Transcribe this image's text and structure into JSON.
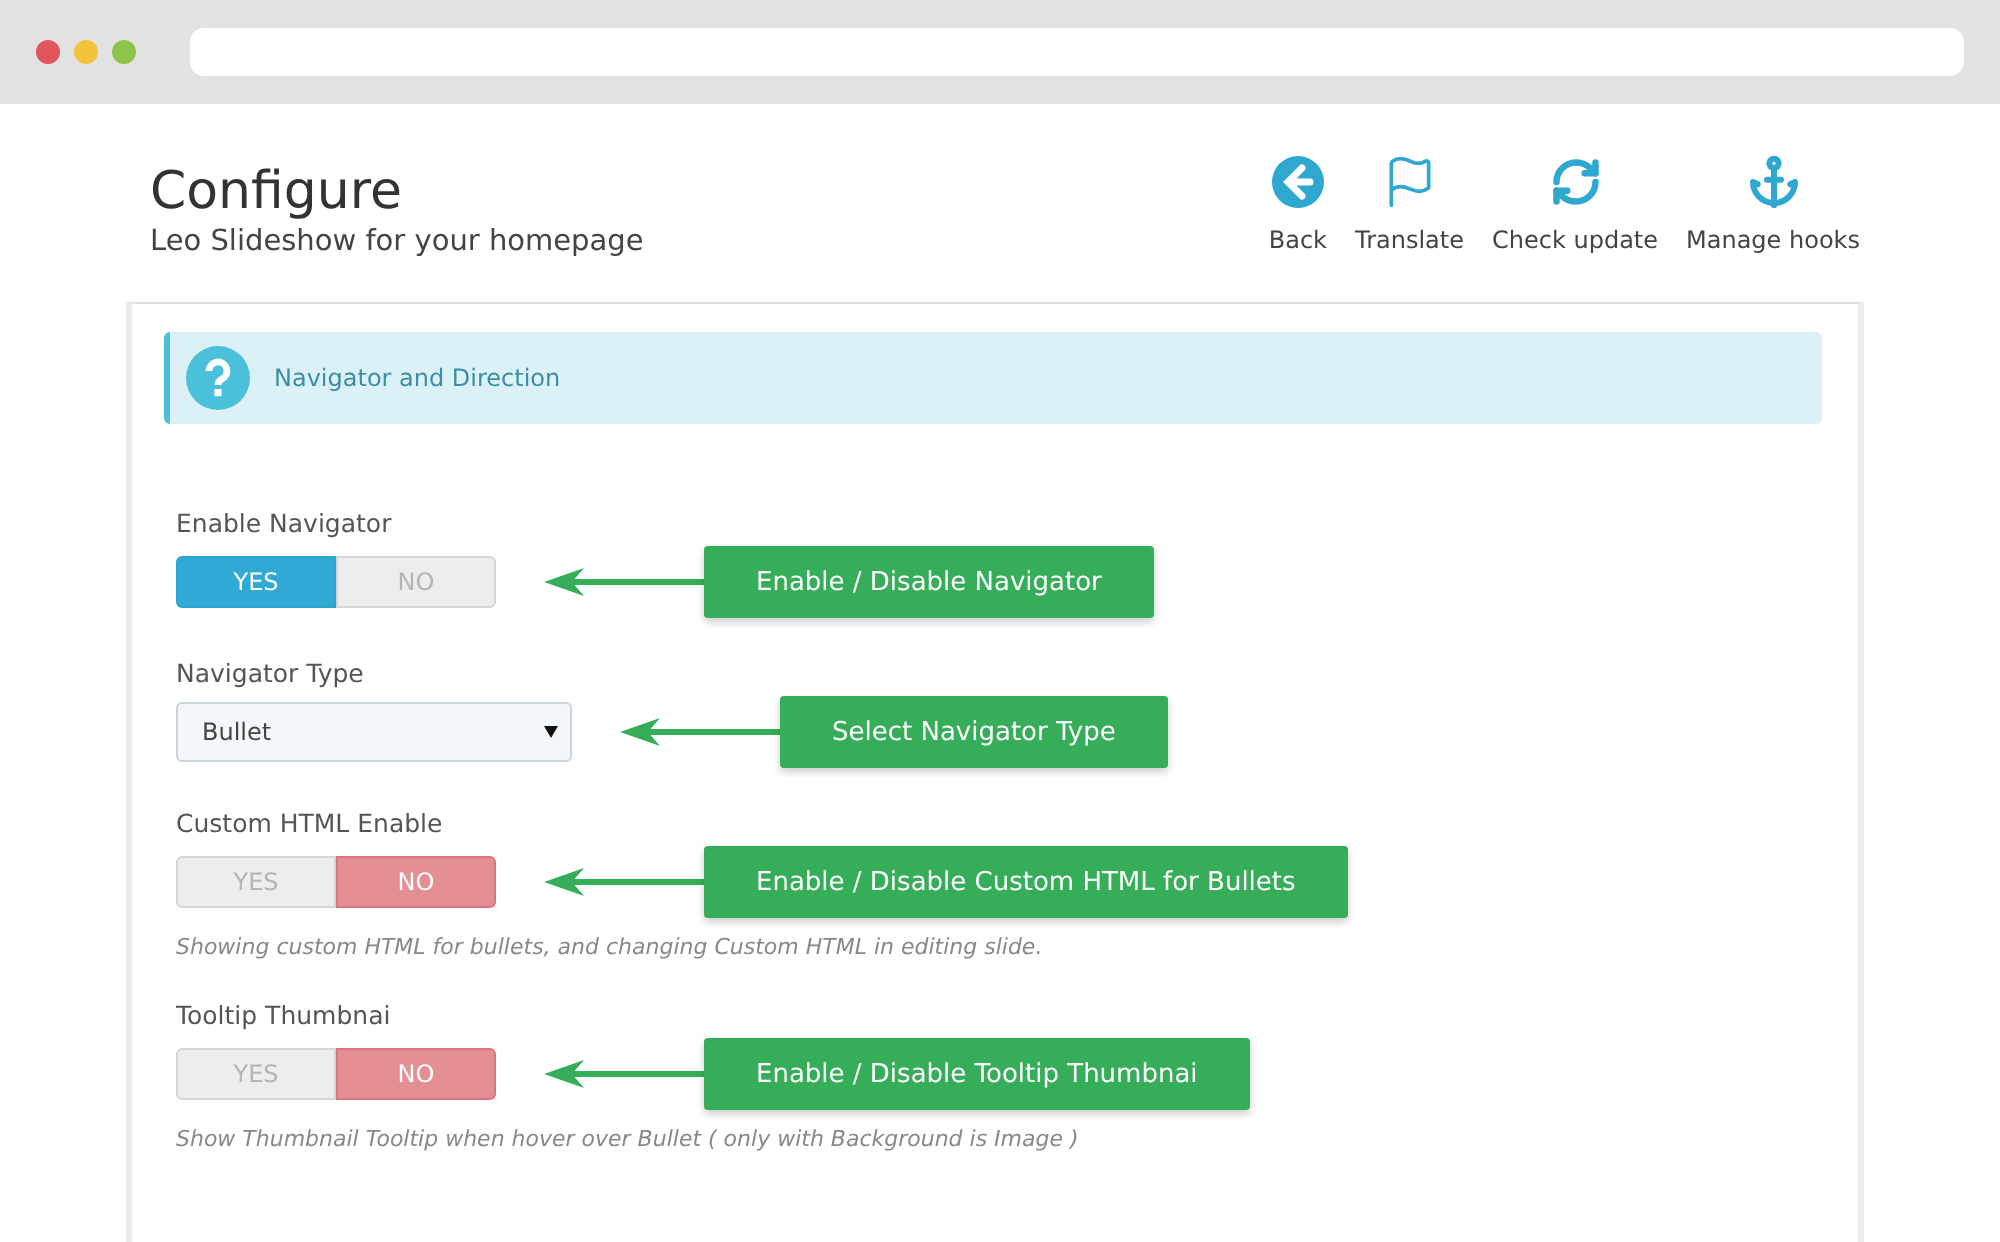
{
  "header": {
    "title": "Configure",
    "subtitle": "Leo Slideshow for your homepage"
  },
  "toolbar": [
    {
      "kind": "back",
      "label": "Back"
    },
    {
      "kind": "flag",
      "label": "Translate"
    },
    {
      "kind": "refresh",
      "label": "Check update"
    },
    {
      "kind": "anchor",
      "label": "Manage hooks"
    }
  ],
  "section": {
    "title": "Navigator and Direction"
  },
  "fields": [
    {
      "kind": "toggle",
      "label": "Enable Navigator",
      "yes": "YES",
      "no": "NO",
      "on": true,
      "callout": "Enable / Disable Navigator"
    },
    {
      "kind": "select",
      "label": "Navigator Type",
      "value": "Bullet",
      "callout": "Select Navigator Type"
    },
    {
      "kind": "toggle",
      "label": "Custom HTML Enable",
      "yes": "YES",
      "no": "NO",
      "on": false,
      "callout": "Enable / Disable Custom HTML for Bullets",
      "help": "Showing custom HTML for bullets, and changing Custom HTML in editing slide."
    },
    {
      "kind": "toggle",
      "label": "Tooltip Thumbnai",
      "yes": "YES",
      "no": "NO",
      "on": false,
      "callout": "Enable / Disable Tooltip Thumbnai",
      "help": "Show Thumbnail Tooltip when hover over Bullet ( only with Background is Image )"
    }
  ]
}
